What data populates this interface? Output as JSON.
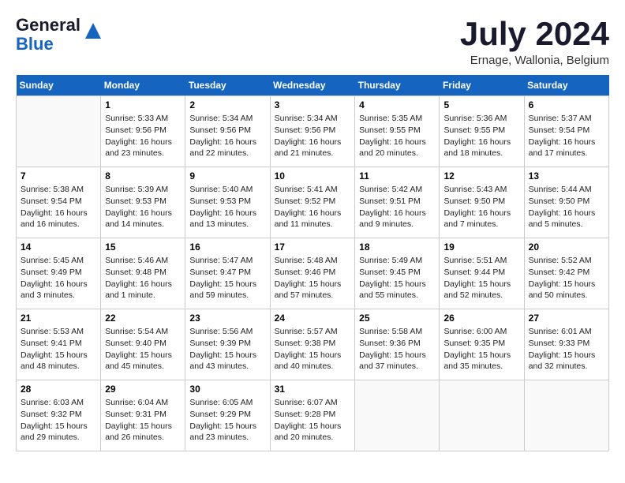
{
  "header": {
    "logo_line1": "General",
    "logo_line2": "Blue",
    "month_title": "July 2024",
    "location": "Ernage, Wallonia, Belgium"
  },
  "weekdays": [
    "Sunday",
    "Monday",
    "Tuesday",
    "Wednesday",
    "Thursday",
    "Friday",
    "Saturday"
  ],
  "weeks": [
    [
      {
        "day": "",
        "sunrise": "",
        "sunset": "",
        "daylight": ""
      },
      {
        "day": "1",
        "sunrise": "Sunrise: 5:33 AM",
        "sunset": "Sunset: 9:56 PM",
        "daylight": "Daylight: 16 hours and 23 minutes."
      },
      {
        "day": "2",
        "sunrise": "Sunrise: 5:34 AM",
        "sunset": "Sunset: 9:56 PM",
        "daylight": "Daylight: 16 hours and 22 minutes."
      },
      {
        "day": "3",
        "sunrise": "Sunrise: 5:34 AM",
        "sunset": "Sunset: 9:56 PM",
        "daylight": "Daylight: 16 hours and 21 minutes."
      },
      {
        "day": "4",
        "sunrise": "Sunrise: 5:35 AM",
        "sunset": "Sunset: 9:55 PM",
        "daylight": "Daylight: 16 hours and 20 minutes."
      },
      {
        "day": "5",
        "sunrise": "Sunrise: 5:36 AM",
        "sunset": "Sunset: 9:55 PM",
        "daylight": "Daylight: 16 hours and 18 minutes."
      },
      {
        "day": "6",
        "sunrise": "Sunrise: 5:37 AM",
        "sunset": "Sunset: 9:54 PM",
        "daylight": "Daylight: 16 hours and 17 minutes."
      }
    ],
    [
      {
        "day": "7",
        "sunrise": "Sunrise: 5:38 AM",
        "sunset": "Sunset: 9:54 PM",
        "daylight": "Daylight: 16 hours and 16 minutes."
      },
      {
        "day": "8",
        "sunrise": "Sunrise: 5:39 AM",
        "sunset": "Sunset: 9:53 PM",
        "daylight": "Daylight: 16 hours and 14 minutes."
      },
      {
        "day": "9",
        "sunrise": "Sunrise: 5:40 AM",
        "sunset": "Sunset: 9:53 PM",
        "daylight": "Daylight: 16 hours and 13 minutes."
      },
      {
        "day": "10",
        "sunrise": "Sunrise: 5:41 AM",
        "sunset": "Sunset: 9:52 PM",
        "daylight": "Daylight: 16 hours and 11 minutes."
      },
      {
        "day": "11",
        "sunrise": "Sunrise: 5:42 AM",
        "sunset": "Sunset: 9:51 PM",
        "daylight": "Daylight: 16 hours and 9 minutes."
      },
      {
        "day": "12",
        "sunrise": "Sunrise: 5:43 AM",
        "sunset": "Sunset: 9:50 PM",
        "daylight": "Daylight: 16 hours and 7 minutes."
      },
      {
        "day": "13",
        "sunrise": "Sunrise: 5:44 AM",
        "sunset": "Sunset: 9:50 PM",
        "daylight": "Daylight: 16 hours and 5 minutes."
      }
    ],
    [
      {
        "day": "14",
        "sunrise": "Sunrise: 5:45 AM",
        "sunset": "Sunset: 9:49 PM",
        "daylight": "Daylight: 16 hours and 3 minutes."
      },
      {
        "day": "15",
        "sunrise": "Sunrise: 5:46 AM",
        "sunset": "Sunset: 9:48 PM",
        "daylight": "Daylight: 16 hours and 1 minute."
      },
      {
        "day": "16",
        "sunrise": "Sunrise: 5:47 AM",
        "sunset": "Sunset: 9:47 PM",
        "daylight": "Daylight: 15 hours and 59 minutes."
      },
      {
        "day": "17",
        "sunrise": "Sunrise: 5:48 AM",
        "sunset": "Sunset: 9:46 PM",
        "daylight": "Daylight: 15 hours and 57 minutes."
      },
      {
        "day": "18",
        "sunrise": "Sunrise: 5:49 AM",
        "sunset": "Sunset: 9:45 PM",
        "daylight": "Daylight: 15 hours and 55 minutes."
      },
      {
        "day": "19",
        "sunrise": "Sunrise: 5:51 AM",
        "sunset": "Sunset: 9:44 PM",
        "daylight": "Daylight: 15 hours and 52 minutes."
      },
      {
        "day": "20",
        "sunrise": "Sunrise: 5:52 AM",
        "sunset": "Sunset: 9:42 PM",
        "daylight": "Daylight: 15 hours and 50 minutes."
      }
    ],
    [
      {
        "day": "21",
        "sunrise": "Sunrise: 5:53 AM",
        "sunset": "Sunset: 9:41 PM",
        "daylight": "Daylight: 15 hours and 48 minutes."
      },
      {
        "day": "22",
        "sunrise": "Sunrise: 5:54 AM",
        "sunset": "Sunset: 9:40 PM",
        "daylight": "Daylight: 15 hours and 45 minutes."
      },
      {
        "day": "23",
        "sunrise": "Sunrise: 5:56 AM",
        "sunset": "Sunset: 9:39 PM",
        "daylight": "Daylight: 15 hours and 43 minutes."
      },
      {
        "day": "24",
        "sunrise": "Sunrise: 5:57 AM",
        "sunset": "Sunset: 9:38 PM",
        "daylight": "Daylight: 15 hours and 40 minutes."
      },
      {
        "day": "25",
        "sunrise": "Sunrise: 5:58 AM",
        "sunset": "Sunset: 9:36 PM",
        "daylight": "Daylight: 15 hours and 37 minutes."
      },
      {
        "day": "26",
        "sunrise": "Sunrise: 6:00 AM",
        "sunset": "Sunset: 9:35 PM",
        "daylight": "Daylight: 15 hours and 35 minutes."
      },
      {
        "day": "27",
        "sunrise": "Sunrise: 6:01 AM",
        "sunset": "Sunset: 9:33 PM",
        "daylight": "Daylight: 15 hours and 32 minutes."
      }
    ],
    [
      {
        "day": "28",
        "sunrise": "Sunrise: 6:03 AM",
        "sunset": "Sunset: 9:32 PM",
        "daylight": "Daylight: 15 hours and 29 minutes."
      },
      {
        "day": "29",
        "sunrise": "Sunrise: 6:04 AM",
        "sunset": "Sunset: 9:31 PM",
        "daylight": "Daylight: 15 hours and 26 minutes."
      },
      {
        "day": "30",
        "sunrise": "Sunrise: 6:05 AM",
        "sunset": "Sunset: 9:29 PM",
        "daylight": "Daylight: 15 hours and 23 minutes."
      },
      {
        "day": "31",
        "sunrise": "Sunrise: 6:07 AM",
        "sunset": "Sunset: 9:28 PM",
        "daylight": "Daylight: 15 hours and 20 minutes."
      },
      {
        "day": "",
        "sunrise": "",
        "sunset": "",
        "daylight": ""
      },
      {
        "day": "",
        "sunrise": "",
        "sunset": "",
        "daylight": ""
      },
      {
        "day": "",
        "sunrise": "",
        "sunset": "",
        "daylight": ""
      }
    ]
  ]
}
